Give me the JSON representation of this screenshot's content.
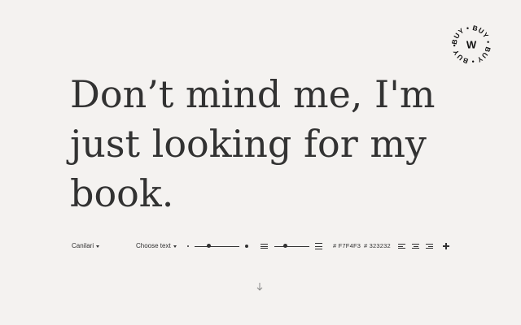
{
  "badge": {
    "ring_text": "BUY • BUY • BUY • BUY •",
    "center_letter": "W",
    "icon": "buy-badge-icon"
  },
  "headline": {
    "text": "Don’t mind me, I'm just looking for my book."
  },
  "toolbar": {
    "font_select": {
      "label": "Canilari",
      "icon": "caret-down-icon"
    },
    "text_select": {
      "label": "Choose text",
      "icon": "caret-down-icon"
    },
    "size_slider": {
      "value_fraction": 0.28,
      "icon_min": "small-dot-icon",
      "icon_max": "large-dot-icon"
    },
    "line_height_slider": {
      "value_fraction": 0.3,
      "icon_min": "tight-lines-icon",
      "icon_max": "loose-lines-icon"
    },
    "background_color": {
      "value": "# F7F4F3"
    },
    "text_color": {
      "value": "# 323232"
    },
    "align_buttons": [
      "align-left-icon",
      "align-center-icon",
      "align-right-icon"
    ],
    "add_icon": "plus-icon"
  },
  "scroll_hint": {
    "icon": "arrow-down-icon"
  },
  "colors": {
    "background": "#F4F2F0",
    "text": "#323232"
  }
}
